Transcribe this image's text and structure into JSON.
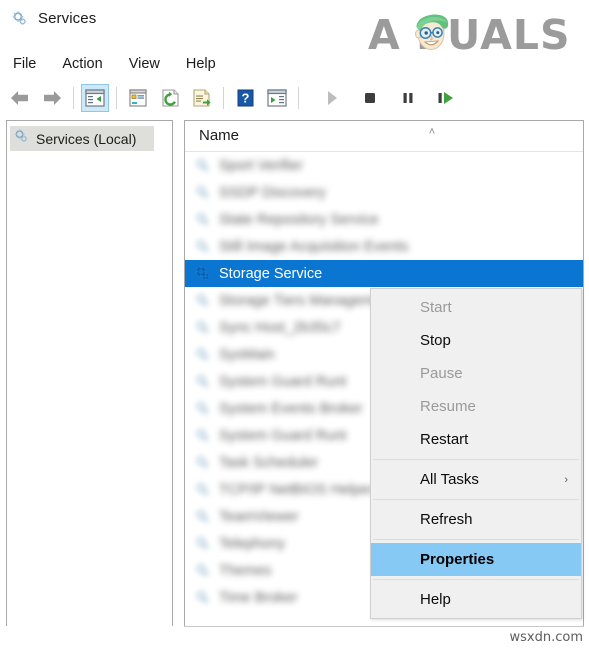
{
  "window": {
    "title": "Services",
    "icon": "services-gear-icon"
  },
  "branding": {
    "logo_text": "A PUALS",
    "logo_prefix": "A",
    "logo_suffix": "PUALS",
    "mascot": "appuals-mascot-icon",
    "logo_color": "#9b9b9b",
    "mascot_hair_color": "#62c17f"
  },
  "menubar": {
    "items": [
      {
        "label": "File"
      },
      {
        "label": "Action"
      },
      {
        "label": "View"
      },
      {
        "label": "Help"
      }
    ]
  },
  "toolbar": {
    "buttons": [
      {
        "name": "back-arrow-icon",
        "label": "Back",
        "pressed": false
      },
      {
        "name": "forward-arrow-icon",
        "label": "Forward",
        "pressed": false
      },
      {
        "name": "show-hide-console-tree-icon",
        "label": "Show/Hide Console Tree",
        "pressed": true
      },
      {
        "name": "properties-window-icon",
        "label": "Properties",
        "pressed": false
      },
      {
        "name": "refresh-icon",
        "label": "Refresh",
        "pressed": false
      },
      {
        "name": "export-list-icon",
        "label": "Export List",
        "pressed": false
      },
      {
        "name": "help-icon",
        "label": "Help",
        "pressed": false
      },
      {
        "name": "show-action-pane-icon",
        "label": "Show/Hide Action Pane",
        "pressed": false
      },
      {
        "name": "start-service-icon",
        "label": "Start Service",
        "pressed": false
      },
      {
        "name": "stop-service-icon",
        "label": "Stop Service",
        "pressed": false
      },
      {
        "name": "pause-service-icon",
        "label": "Pause Service",
        "pressed": false
      },
      {
        "name": "restart-service-icon",
        "label": "Restart Service",
        "pressed": false
      }
    ]
  },
  "tree": {
    "root": {
      "label": "Services (Local)",
      "icon": "services-gear-icon",
      "selected": true
    }
  },
  "list": {
    "columns": [
      {
        "label": "Name",
        "sort_indicator": "˄"
      }
    ],
    "rows": [
      {
        "label": "Sport Verifier",
        "blurred": true,
        "selected": false
      },
      {
        "label": "SSDP Discovery",
        "blurred": true,
        "selected": false
      },
      {
        "label": "State Repository Service",
        "blurred": true,
        "selected": false
      },
      {
        "label": "Still Image Acquisition Events",
        "blurred": true,
        "selected": false
      },
      {
        "label": "Storage Service",
        "blurred": false,
        "selected": true
      },
      {
        "label": "Storage Tiers Management",
        "blurred": true,
        "selected": false
      },
      {
        "label": "Sync Host_2b35c7",
        "blurred": true,
        "selected": false
      },
      {
        "label": "SysMain",
        "blurred": true,
        "selected": false
      },
      {
        "label": "System Guard Runt",
        "blurred": true,
        "selected": false
      },
      {
        "label": "System Events Broker",
        "blurred": true,
        "selected": false
      },
      {
        "label": "System Guard Runt",
        "blurred": true,
        "selected": false
      },
      {
        "label": "Task Scheduler",
        "blurred": true,
        "selected": false
      },
      {
        "label": "TCP/IP NetBIOS Helper",
        "blurred": true,
        "selected": false
      },
      {
        "label": "TeamViewer",
        "blurred": true,
        "selected": false
      },
      {
        "label": "Telephony",
        "blurred": true,
        "selected": false
      },
      {
        "label": "Themes",
        "blurred": true,
        "selected": false
      },
      {
        "label": "Time Broker",
        "blurred": true,
        "selected": false
      }
    ]
  },
  "context_menu": {
    "items": [
      {
        "label": "Start",
        "state": "disabled",
        "type": "item"
      },
      {
        "label": "Stop",
        "state": "enabled",
        "type": "item"
      },
      {
        "label": "Pause",
        "state": "disabled",
        "type": "item"
      },
      {
        "label": "Resume",
        "state": "disabled",
        "type": "item"
      },
      {
        "label": "Restart",
        "state": "enabled",
        "type": "item"
      },
      {
        "label": "",
        "state": "",
        "type": "separator"
      },
      {
        "label": "All Tasks",
        "state": "enabled",
        "type": "submenu",
        "arrow": "›"
      },
      {
        "label": "",
        "state": "",
        "type": "separator"
      },
      {
        "label": "Refresh",
        "state": "enabled",
        "type": "item"
      },
      {
        "label": "",
        "state": "",
        "type": "separator"
      },
      {
        "label": "Properties",
        "state": "highlight",
        "type": "item"
      },
      {
        "label": "",
        "state": "",
        "type": "separator"
      },
      {
        "label": "Help",
        "state": "enabled",
        "type": "item"
      }
    ],
    "highlight_color": "#87c9f5"
  },
  "watermark": {
    "text": "wsxdn.com"
  },
  "colors": {
    "selection_blue": "#0b76d1",
    "menu_background": "#f0f0f0",
    "toolbar_pressed": "#cde8f7"
  }
}
